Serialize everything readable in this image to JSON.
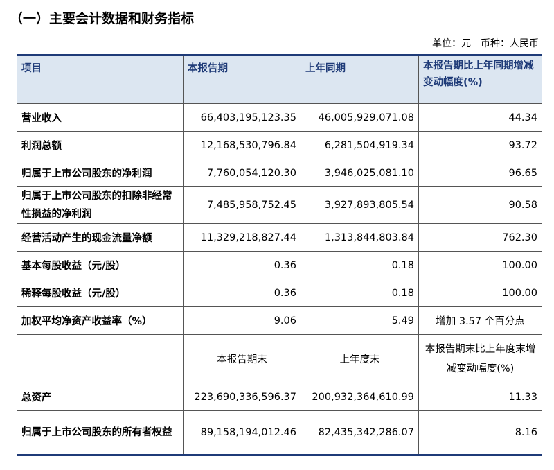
{
  "title": "（一）主要会计数据和财务指标",
  "unit_note": "单位：元　币种：人民币",
  "table": {
    "header": [
      "项目",
      "本报告期",
      "上年同期",
      "本报告期比上年同期增减变动幅度(%)"
    ],
    "rows": [
      {
        "item": "营业收入",
        "current": "66,403,195,123.35",
        "prior": "46,005,929,071.08",
        "change": "44.34"
      },
      {
        "item": "利润总额",
        "current": "12,168,530,796.84",
        "prior": "6,281,504,919.34",
        "change": "93.72"
      },
      {
        "item": "归属于上市公司股东的净利润",
        "current": "7,760,054,120.30",
        "prior": "3,946,025,081.10",
        "change": "96.65"
      },
      {
        "item": "归属于上市公司股东的扣除非经常性损益的净利润",
        "current": "7,485,958,752.45",
        "prior": "3,927,893,805.54",
        "change": "90.58"
      },
      {
        "item": "经营活动产生的现金流量净额",
        "current": "11,329,218,827.44",
        "prior": "1,313,844,803.84",
        "change": "762.30"
      },
      {
        "item": "基本每股收益（元/股）",
        "current": "0.36",
        "prior": "0.18",
        "change": "100.00"
      },
      {
        "item": "稀释每股收益（元/股）",
        "current": "0.36",
        "prior": "0.18",
        "change": "100.00"
      },
      {
        "item": "加权平均净资产收益率（%）",
        "current": "9.06",
        "prior": "5.49",
        "change": "增加 3.57 个百分点"
      }
    ],
    "subheader": [
      "",
      "本报告期末",
      "上年度末",
      "本报告期末比上年度末增减变动幅度(%)"
    ],
    "rows2": [
      {
        "item": "总资产",
        "current": "223,690,336,596.37",
        "prior": "200,932,364,610.99",
        "change": "11.33"
      },
      {
        "item": "归属于上市公司股东的所有者权益",
        "current": "89,158,194,012.46",
        "prior": "82,435,342,286.07",
        "change": "8.16"
      }
    ]
  }
}
